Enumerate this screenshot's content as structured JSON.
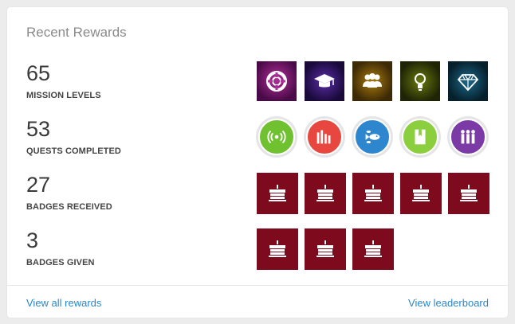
{
  "card": {
    "title": "Recent Rewards"
  },
  "rows": [
    {
      "number": "65",
      "label": "MISSION LEVELS",
      "icons": [
        "lifebuoy-icon",
        "graduation-cap-icon",
        "group-icon",
        "lightbulb-icon",
        "diamond-icon"
      ]
    },
    {
      "number": "53",
      "label": "QUESTS COMPLETED",
      "icons": [
        "broadcast-icon",
        "bar-chart-icon",
        "fish-icon",
        "bookmark-icon",
        "people-icon"
      ]
    },
    {
      "number": "27",
      "label": "BADGES RECEIVED",
      "icons": [
        "cake-icon",
        "cake-icon",
        "cake-icon",
        "cake-icon",
        "cake-icon"
      ]
    },
    {
      "number": "3",
      "label": "BADGES GIVEN",
      "icons": [
        "cake-icon",
        "cake-icon",
        "cake-icon"
      ]
    }
  ],
  "footer": {
    "view_all": "View all rewards",
    "leaderboard": "View leaderboard"
  },
  "colors": {
    "accent_link": "#2a87c9",
    "cake_tile": "#7e0a1d"
  }
}
